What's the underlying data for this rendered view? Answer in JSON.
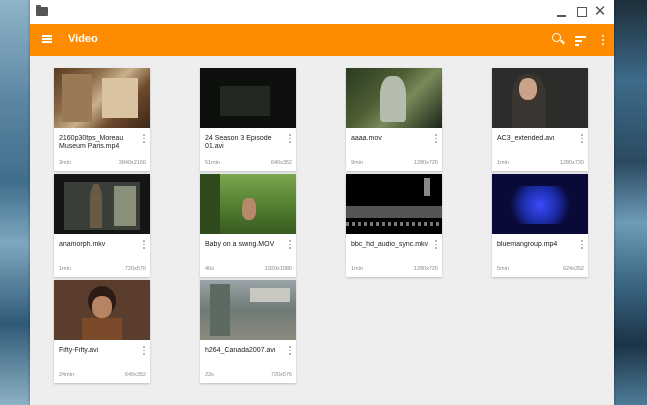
{
  "window": {
    "title_bar": {
      "minimize_glyph": "",
      "maximize_glyph": "",
      "close_glyph": "✕"
    },
    "toolbar": {
      "title": "Video",
      "background_color": "#ff8c00",
      "icons": [
        "menu-icon",
        "search-icon",
        "sort-icon",
        "more-vert-icon"
      ]
    }
  },
  "videos": [
    {
      "title": "2160p30fps_Moreau Museum Paris.mp4",
      "duration": "3min",
      "resolution": "3840x2160"
    },
    {
      "title": "24 Season 3 Episode 01.avi",
      "duration": "51min",
      "resolution": "640x352"
    },
    {
      "title": "aaaa.mov",
      "duration": "9min",
      "resolution": "1280x720"
    },
    {
      "title": "AC3_extended.avi",
      "duration": "1min",
      "resolution": "1280x720"
    },
    {
      "title": "anamorph.mkv",
      "duration": "1min",
      "resolution": "720x576"
    },
    {
      "title": "Baby on a swing.MOV",
      "duration": "40s",
      "resolution": "1920x1080"
    },
    {
      "title": "bbc_hd_audio_sync.mkv",
      "duration": "1min",
      "resolution": "1280x720"
    },
    {
      "title": "bluemangroup.mp4",
      "duration": "5min",
      "resolution": "624x352"
    },
    {
      "title": "Fifty-Fifty.avi",
      "duration": "24min",
      "resolution": "640x352"
    },
    {
      "title": "h264_Canada2007.avi",
      "duration": "23s",
      "resolution": "720x576"
    }
  ]
}
